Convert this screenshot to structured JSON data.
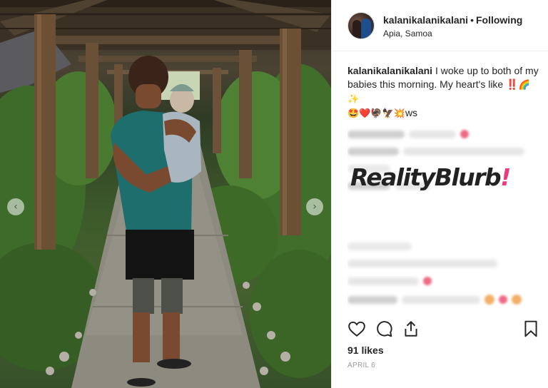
{
  "post": {
    "username": "kalanikalanikalani",
    "separator": "•",
    "follow_status": "Following",
    "location": "Apia, Samoa",
    "caption_user": "kalanikalanikalani",
    "caption_text": " I woke up to both of my babies this morning. My heart's like ‼️",
    "caption_emojis_1": "🌈✨",
    "caption_emojis_2": "🤩❤️🦃🦅💥",
    "caption_tail": "ws",
    "likes": "91 likes",
    "date": "APRIL 6"
  },
  "watermark": {
    "text": "RealityBlurb",
    "bang": "!"
  },
  "carousel": {
    "prev_icon": "chevron-left-icon",
    "next_icon": "chevron-right-icon",
    "prev_glyph": "‹",
    "next_glyph": "›"
  },
  "actions": {
    "like_icon": "heart-icon",
    "comment_icon": "comment-icon",
    "share_icon": "share-icon",
    "save_icon": "bookmark-icon"
  },
  "colors": {
    "text": "#262626",
    "muted": "#999999",
    "watermark_accent": "#e83b7e",
    "border": "#efefef"
  }
}
